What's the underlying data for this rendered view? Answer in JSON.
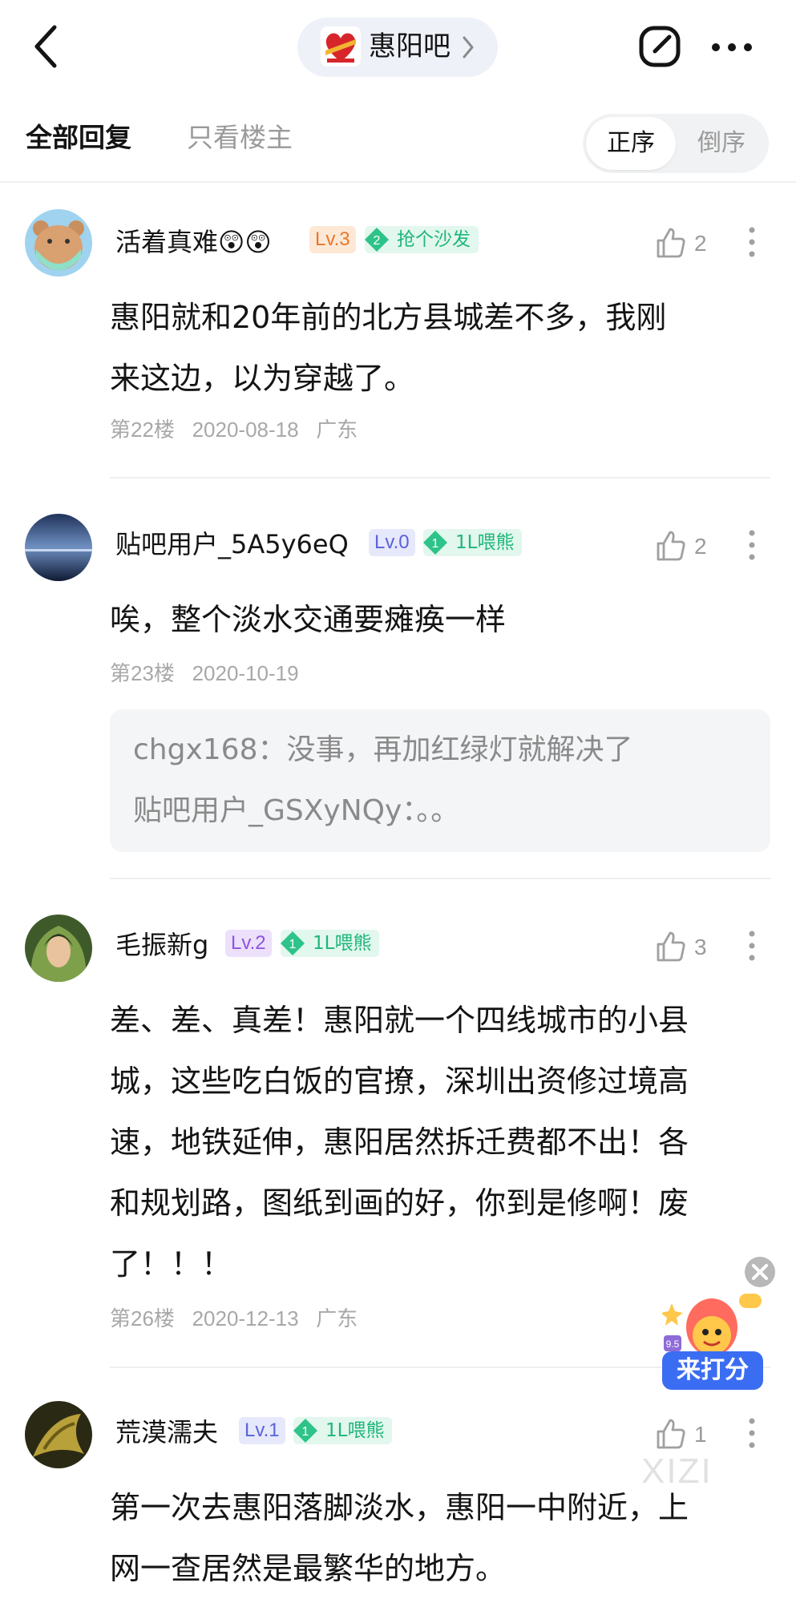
{
  "header": {
    "forum_name": "惠阳吧"
  },
  "tabs": {
    "all": "全部回复",
    "owner_only": "只看楼主"
  },
  "order": {
    "asc": "正序",
    "desc": "倒序"
  },
  "posts": [
    {
      "username": "活着真难😲😲",
      "level": "Lv.3",
      "badge_num": "2",
      "badge_text": "抢个沙发",
      "likes": "2",
      "content_lines": [
        "惠阳就和20年前的北方县城差不多，我刚",
        "来这边，以为穿越了。"
      ],
      "floor": "第22楼",
      "date": "2020-08-18",
      "location": "广东"
    },
    {
      "username": "贴吧用户_5A5y6eQ",
      "level": "Lv.0",
      "badge_num": "1",
      "badge_text": "1L喂熊",
      "likes": "2",
      "content_lines": [
        "唉，整个淡水交通要瘫痪一样"
      ],
      "floor": "第23楼",
      "date": "2020-10-19",
      "replies": [
        {
          "user": "chgx168",
          "text": "：没事，再加红绿灯就解决了"
        },
        {
          "user": "贴吧用户_GSXyNQy",
          "text": "：。。"
        }
      ]
    },
    {
      "username": "毛振新g",
      "level": "Lv.2",
      "badge_num": "1",
      "badge_text": "1L喂熊",
      "likes": "3",
      "content_lines": [
        "差、差、真差！惠阳就一个四线城市的小县",
        "城，这些吃白饭的官撩，深圳出资修过境高",
        "速，地铁延伸，惠阳居然拆迁费都不出！各",
        "和规划路，图纸到画的好，你到是修啊！废",
        "了！！！"
      ],
      "floor": "第26楼",
      "date": "2020-12-13",
      "location": "广东"
    },
    {
      "username": "荒漠濡夫",
      "level": "Lv.1",
      "badge_num": "1",
      "badge_text": "1L喂熊",
      "likes": "1",
      "content_lines": [
        "第一次去惠阳落脚淡水，惠阳一中附近，上",
        "网一查居然是最繁华的地方。"
      ]
    }
  ],
  "floating": {
    "rate_label": "来打分",
    "rate_score": "9.5"
  },
  "watermark": "XIZI",
  "colors": {
    "badge_green": "#1fb67a",
    "rate_blue": "#3b6df2"
  }
}
